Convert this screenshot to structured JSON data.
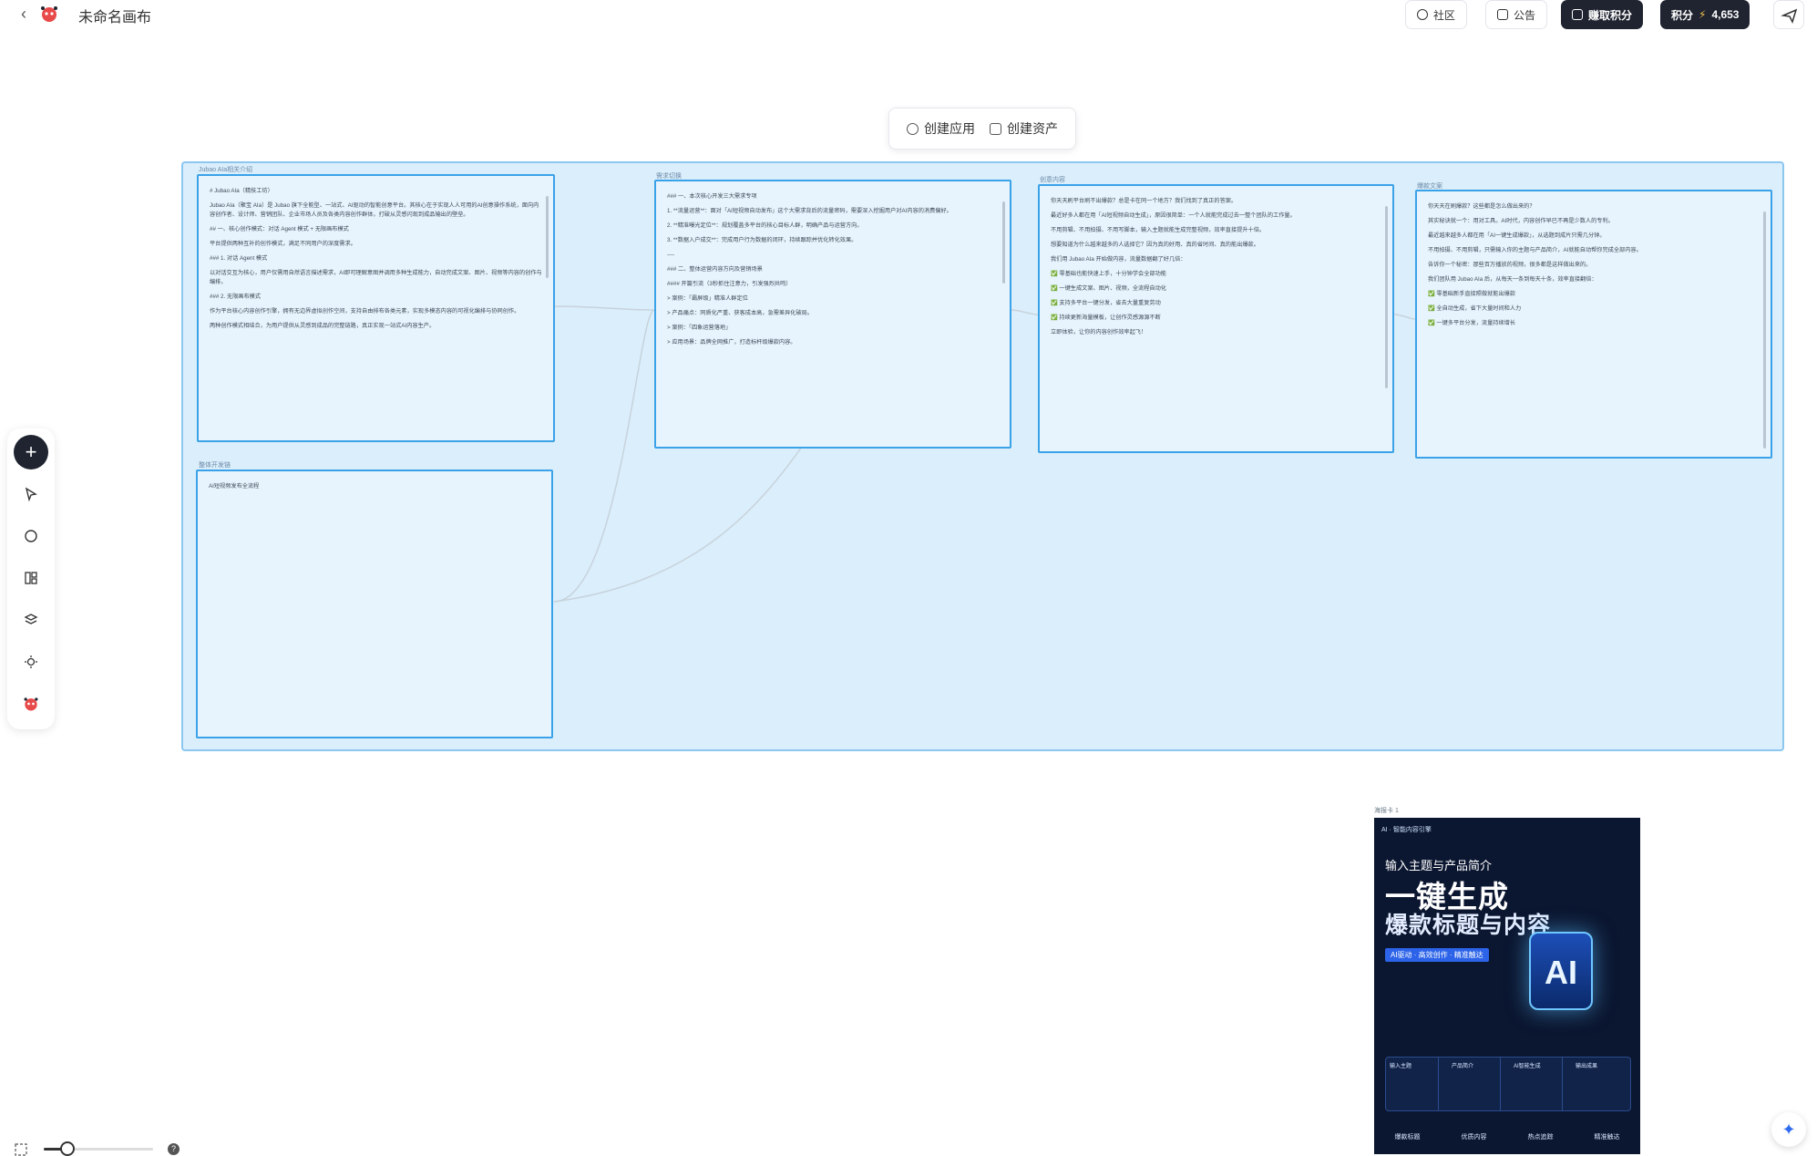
{
  "header": {
    "back_glyph": "‹",
    "title": "未命名画布",
    "community_label": "社区",
    "notice_label": "公告",
    "earn_points_label": "赚取积分",
    "points_label": "积分",
    "points_value": "4,653"
  },
  "create_menu": {
    "create_app_label": "创建应用",
    "create_asset_label": "创建资产"
  },
  "cards": [
    {
      "label": "Jubao AIa相关介绍",
      "paragraphs": [
        "# Jubao AIa（精技工坊）",
        "Jubao AIa（聚宝 AIa）是 Jubao 旗下全能型、一站式、AI驱动的智能创意平台。其核心在于实现人人可用的AI创意操作系统，面向内容创作者、设计师、营销团队、企业市场人员及各类内容创作群体，打破从灵感闪现到成品输出的壁垒。",
        "## 一、核心创作模式：对话 Agent 模式 + 无限画布模式",
        "平台提供两种互补的创作模式，满足不同用户的深度需求。",
        "### 1. 对话 Agent 模式",
        "以对话交互为核心，用户仅需用自然语言描述需求，AI即可理解意图并调用多种生成能力，自动完成文案、图片、视频等内容的创作与编排。",
        "### 2. 无限画布模式",
        "作为平台核心内容创作引擎，拥有无边界虚拟创作空间，支持自由排布各类元素，实现多模态内容的可视化编排与协同创作。",
        "两种创作模式相结合，为用户提供从灵感到成品的完整链路，真正实现一站式AI内容生产。"
      ]
    },
    {
      "label": "需求切换",
      "paragraphs": [
        "### 一、本次核心开发三大需求专项",
        "1. **流量运营**：面对「AI短视频自动发布」这个大需求背后的流量密码，需要深入挖掘用户对AI内容的消费偏好。",
        "2. **精准曝光定位**：规划覆盖多平台的核心目标人群，明确产品与运营方向。",
        "3. **数据入户成交**：完成用户行为数据的闭环，持续跟踪并优化转化效果。",
        "----",
        "### 二、整体运营内容方向及营销场景",
        "#### 开篇引流（3秒抓住注意力，引发强烈共鸣）",
        "> 案例：「霸屏级」精准人群定位",
        "> 产品痛点：同质化严重、获客成本高，急需差异化破局。",
        "> 案例：「四象运营落地」",
        "> 应用场景：品牌全网推广，打造标杆级爆款内容。"
      ]
    },
    {
      "label": "创意内容",
      "paragraphs": [
        "你天天刷平台刷不出爆款？总是卡在同一个地方？我们找到了真正的答案。",
        "最近好多人都在用「AI短视频自动生成」，原因很简单：一个人就能完成过去一整个团队的工作量。",
        "不用剪辑、不用拍摄、不用写脚本，输入主题就能生成完整视频，效率直接提升十倍。",
        "想要知道为什么越来越多的人选择它？因为真的好用、真的省时间、真的能出爆款。",
        "我们用 Jubao AIa 开始做内容，流量数据翻了好几倍：",
        "✅ 零基础也能快速上手，十分钟学会全部功能",
        "✅ 一键生成文案、图片、视频，全流程自动化",
        "✅ 支持多平台一键分发，省去大量重复劳动",
        "✅ 持续更新海量模板，让创作灵感源源不断",
        "立即体验，让你的内容创作效率起飞！"
      ]
    },
    {
      "label": "爆款文案",
      "paragraphs": [
        "你天天在刷爆款？这些都是怎么做出来的？",
        "其实秘诀就一个：用对工具。AI时代，内容创作早已不再是少数人的专利。",
        "最近越来越多人都在用「AI一键生成爆款」，从选题到成片只需几分钟。",
        "不用拍摄、不用剪辑，只需输入你的主题与产品简介，AI就能自动帮你完成全部内容。",
        "告诉你一个秘密：那些百万播放的视频，很多都是这样做出来的。",
        "我们团队用 Jubao AIa 后，从每天一条到每天十条，效率直接翻倍：",
        "✅ 零基础新手直接照做就能出爆款",
        "✅ 全自动生成，省下大量时间和人力",
        "✅ 一键多平台分发，流量持续增长"
      ]
    },
    {
      "label": "整体开发链",
      "paragraphs": [
        "AI短视频发布全流程"
      ]
    }
  ],
  "poster": {
    "label": "海报卡 1",
    "tag": "AI · 智能内容引擎",
    "subtitle": "输入主题与产品简介",
    "headline_1": "一键生成",
    "headline_2": "爆款标题与内容",
    "chip": "AI驱动 · 高效创作 · 精准触达",
    "ai_text": "AI",
    "steps": [
      "输入主题",
      "产品简介",
      "AI智能生成",
      "输出成果"
    ],
    "footer": [
      "爆款标题",
      "优质内容",
      "热点追踪",
      "精准触达"
    ]
  },
  "zoom": {
    "level": 0.22
  },
  "colors": {
    "group_fill": "#dbeefb",
    "card_border": "#3aa2e8",
    "primary_dark": "#1f2430",
    "accent_blue": "#2f6cf0"
  },
  "icons": {
    "toolbar": [
      "plus-icon",
      "cursor-icon",
      "chat-icon",
      "layout-icon",
      "layers-icon",
      "sun-icon",
      "logo-icon"
    ],
    "fab": "sparkle-icon"
  }
}
